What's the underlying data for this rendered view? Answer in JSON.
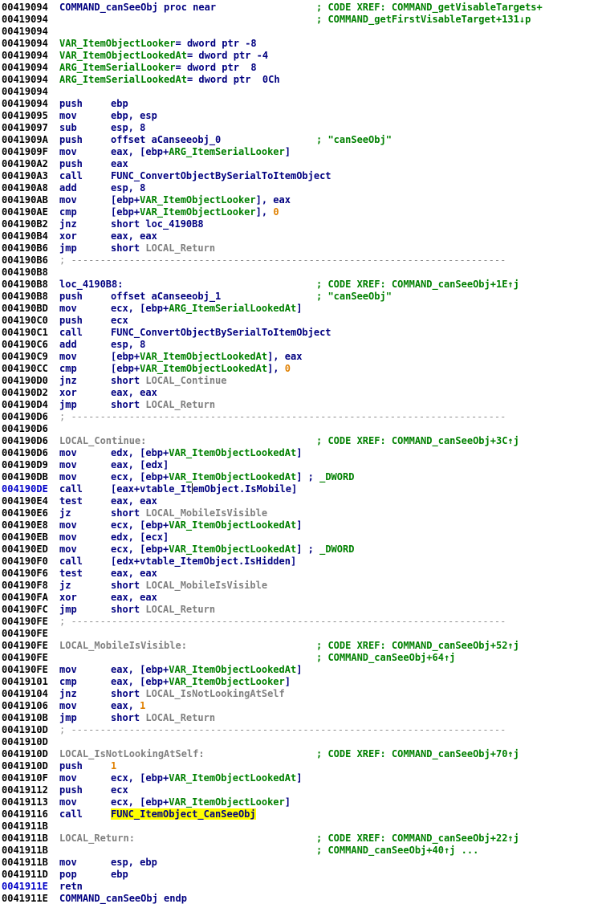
{
  "colors": {
    "background": "#ffffff",
    "address": "#000000",
    "current_address": "#0000c8",
    "instruction": "#000080",
    "comment": "#008000",
    "local_label": "#808080",
    "number": "#e08000",
    "highlight": "#ffff00"
  },
  "lines": [
    {
      "addr": "00419094",
      "lbl": [
        {
          "t": "COMMAND_canSeeObj proc near"
        }
      ],
      "cm": "; CODE XREF: COMMAND_getVisableTargets+"
    },
    {
      "addr": "00419094",
      "cm": "; COMMAND_getFirstVisableTarget+131↓p"
    },
    {
      "addr": "00419094"
    },
    {
      "addr": "00419094",
      "lbl": [
        {
          "t": "VAR_ItemObjectLooker",
          "k": "g"
        },
        {
          "t": "= dword ptr -8"
        }
      ]
    },
    {
      "addr": "00419094",
      "lbl": [
        {
          "t": "VAR_ItemObjectLookedAt",
          "k": "g"
        },
        {
          "t": "= dword ptr -4"
        }
      ]
    },
    {
      "addr": "00419094",
      "lbl": [
        {
          "t": "ARG_ItemSerialLooker",
          "k": "g"
        },
        {
          "t": "= dword ptr  8"
        }
      ]
    },
    {
      "addr": "00419094",
      "lbl": [
        {
          "t": "ARG_ItemSerialLookedAt",
          "k": "g"
        },
        {
          "t": "= dword ptr  0Ch"
        }
      ]
    },
    {
      "addr": "00419094"
    },
    {
      "addr": "00419094",
      "mn": "push",
      "op": [
        {
          "t": "ebp"
        }
      ]
    },
    {
      "addr": "00419095",
      "mn": "mov",
      "op": [
        {
          "t": "ebp, esp"
        }
      ]
    },
    {
      "addr": "00419097",
      "mn": "sub",
      "op": [
        {
          "t": "esp, 8"
        }
      ]
    },
    {
      "addr": "0041909A",
      "mn": "push",
      "op": [
        {
          "t": "offset aCanseeobj_0"
        }
      ],
      "cm": "; \"canSeeObj\""
    },
    {
      "addr": "0041909F",
      "mn": "mov",
      "op": [
        {
          "t": "eax, [ebp+"
        },
        {
          "t": "ARG_ItemSerialLooker",
          "k": "g"
        },
        {
          "t": "]"
        }
      ]
    },
    {
      "addr": "004190A2",
      "mn": "push",
      "op": [
        {
          "t": "eax"
        }
      ]
    },
    {
      "addr": "004190A3",
      "mn": "call",
      "op": [
        {
          "t": "FUNC_ConvertObjectBySerialToItemObject"
        }
      ]
    },
    {
      "addr": "004190A8",
      "mn": "add",
      "op": [
        {
          "t": "esp, 8"
        }
      ]
    },
    {
      "addr": "004190AB",
      "mn": "mov",
      "op": [
        {
          "t": "[ebp+"
        },
        {
          "t": "VAR_ItemObjectLooker",
          "k": "g"
        },
        {
          "t": "], eax"
        }
      ]
    },
    {
      "addr": "004190AE",
      "mn": "cmp",
      "op": [
        {
          "t": "[ebp+"
        },
        {
          "t": "VAR_ItemObjectLooker",
          "k": "g"
        },
        {
          "t": "], "
        },
        {
          "t": "0",
          "k": "nm"
        }
      ]
    },
    {
      "addr": "004190B2",
      "mn": "jnz",
      "op": [
        {
          "t": "short loc_4190B8"
        }
      ]
    },
    {
      "addr": "004190B4",
      "mn": "xor",
      "op": [
        {
          "t": "eax, eax"
        }
      ]
    },
    {
      "addr": "004190B6",
      "mn": "jmp",
      "op": [
        {
          "t": "short "
        },
        {
          "t": "LOCAL_Return",
          "k": "gr"
        }
      ]
    },
    {
      "addr": "004190B6",
      "sep": "; ---------------------------------------------------------------------------"
    },
    {
      "addr": "004190B8"
    },
    {
      "addr": "004190B8",
      "lbl": [
        {
          "t": "loc_4190B8:"
        }
      ],
      "cm": "; CODE XREF: COMMAND_canSeeObj+1E↑j"
    },
    {
      "addr": "004190B8",
      "mn": "push",
      "op": [
        {
          "t": "offset aCanseeobj_1"
        }
      ],
      "cm": "; \"canSeeObj\""
    },
    {
      "addr": "004190BD",
      "mn": "mov",
      "op": [
        {
          "t": "ecx, [ebp+"
        },
        {
          "t": "ARG_ItemSerialLookedAt",
          "k": "g"
        },
        {
          "t": "]"
        }
      ]
    },
    {
      "addr": "004190C0",
      "mn": "push",
      "op": [
        {
          "t": "ecx"
        }
      ]
    },
    {
      "addr": "004190C1",
      "mn": "call",
      "op": [
        {
          "t": "FUNC_ConvertObjectBySerialToItemObject"
        }
      ]
    },
    {
      "addr": "004190C6",
      "mn": "add",
      "op": [
        {
          "t": "esp, 8"
        }
      ]
    },
    {
      "addr": "004190C9",
      "mn": "mov",
      "op": [
        {
          "t": "[ebp+"
        },
        {
          "t": "VAR_ItemObjectLookedAt",
          "k": "g"
        },
        {
          "t": "], eax"
        }
      ]
    },
    {
      "addr": "004190CC",
      "mn": "cmp",
      "op": [
        {
          "t": "[ebp+"
        },
        {
          "t": "VAR_ItemObjectLookedAt",
          "k": "g"
        },
        {
          "t": "], "
        },
        {
          "t": "0",
          "k": "nm"
        }
      ]
    },
    {
      "addr": "004190D0",
      "mn": "jnz",
      "op": [
        {
          "t": "short "
        },
        {
          "t": "LOCAL_Continue",
          "k": "gr"
        }
      ]
    },
    {
      "addr": "004190D2",
      "mn": "xor",
      "op": [
        {
          "t": "eax, eax"
        }
      ]
    },
    {
      "addr": "004190D4",
      "mn": "jmp",
      "op": [
        {
          "t": "short "
        },
        {
          "t": "LOCAL_Return",
          "k": "gr"
        }
      ]
    },
    {
      "addr": "004190D6",
      "sep": "; ---------------------------------------------------------------------------"
    },
    {
      "addr": "004190D6"
    },
    {
      "addr": "004190D6",
      "lbl": [
        {
          "t": "LOCAL_Continue:",
          "k": "gr"
        }
      ],
      "cm": "; CODE XREF: COMMAND_canSeeObj+3C↑j"
    },
    {
      "addr": "004190D6",
      "mn": "mov",
      "op": [
        {
          "t": "edx, [ebp+"
        },
        {
          "t": "VAR_ItemObjectLookedAt",
          "k": "g"
        },
        {
          "t": "]"
        }
      ]
    },
    {
      "addr": "004190D9",
      "mn": "mov",
      "op": [
        {
          "t": "eax, [edx]"
        }
      ]
    },
    {
      "addr": "004190DB",
      "mn": "mov",
      "op": [
        {
          "t": "ecx, [ebp+"
        },
        {
          "t": "VAR_ItemObjectLookedAt",
          "k": "g"
        },
        {
          "t": "] ; "
        },
        {
          "t": "_DWORD",
          "k": "g"
        }
      ]
    },
    {
      "addr": "004190DE",
      "cur": true,
      "mn": "call",
      "op": [
        {
          "t": "[eax+vtable_It"
        },
        {
          "k": "cursor"
        },
        {
          "t": "emObject.IsMobile]"
        }
      ]
    },
    {
      "addr": "004190E4",
      "mn": "test",
      "op": [
        {
          "t": "eax, eax"
        }
      ]
    },
    {
      "addr": "004190E6",
      "mn": "jz",
      "op": [
        {
          "t": "short "
        },
        {
          "t": "LOCAL_MobileIsVisible",
          "k": "gr"
        }
      ]
    },
    {
      "addr": "004190E8",
      "mn": "mov",
      "op": [
        {
          "t": "ecx, [ebp+"
        },
        {
          "t": "VAR_ItemObjectLookedAt",
          "k": "g"
        },
        {
          "t": "]"
        }
      ]
    },
    {
      "addr": "004190EB",
      "mn": "mov",
      "op": [
        {
          "t": "edx, [ecx]"
        }
      ]
    },
    {
      "addr": "004190ED",
      "mn": "mov",
      "op": [
        {
          "t": "ecx, [ebp+"
        },
        {
          "t": "VAR_ItemObjectLookedAt",
          "k": "g"
        },
        {
          "t": "] ; "
        },
        {
          "t": "_DWORD",
          "k": "g"
        }
      ]
    },
    {
      "addr": "004190F0",
      "mn": "call",
      "op": [
        {
          "t": "[edx+vtable_ItemObject.IsHidden]"
        }
      ]
    },
    {
      "addr": "004190F6",
      "mn": "test",
      "op": [
        {
          "t": "eax, eax"
        }
      ]
    },
    {
      "addr": "004190F8",
      "mn": "jz",
      "op": [
        {
          "t": "short "
        },
        {
          "t": "LOCAL_MobileIsVisible",
          "k": "gr"
        }
      ]
    },
    {
      "addr": "004190FA",
      "mn": "xor",
      "op": [
        {
          "t": "eax, eax"
        }
      ]
    },
    {
      "addr": "004190FC",
      "mn": "jmp",
      "op": [
        {
          "t": "short "
        },
        {
          "t": "LOCAL_Return",
          "k": "gr"
        }
      ]
    },
    {
      "addr": "004190FE",
      "sep": "; ---------------------------------------------------------------------------"
    },
    {
      "addr": "004190FE"
    },
    {
      "addr": "004190FE",
      "lbl": [
        {
          "t": "LOCAL_MobileIsVisible:",
          "k": "gr"
        }
      ],
      "cm": "; CODE XREF: COMMAND_canSeeObj+52↑j"
    },
    {
      "addr": "004190FE",
      "cm": "; COMMAND_canSeeObj+64↑j"
    },
    {
      "addr": "004190FE",
      "mn": "mov",
      "op": [
        {
          "t": "eax, [ebp+"
        },
        {
          "t": "VAR_ItemObjectLookedAt",
          "k": "g"
        },
        {
          "t": "]"
        }
      ]
    },
    {
      "addr": "00419101",
      "mn": "cmp",
      "op": [
        {
          "t": "eax, [ebp+"
        },
        {
          "t": "VAR_ItemObjectLooker",
          "k": "g"
        },
        {
          "t": "]"
        }
      ]
    },
    {
      "addr": "00419104",
      "mn": "jnz",
      "op": [
        {
          "t": "short "
        },
        {
          "t": "LOCAL_IsNotLookingAtSelf",
          "k": "gr"
        }
      ]
    },
    {
      "addr": "00419106",
      "mn": "mov",
      "op": [
        {
          "t": "eax, "
        },
        {
          "t": "1",
          "k": "nm"
        }
      ]
    },
    {
      "addr": "0041910B",
      "mn": "jmp",
      "op": [
        {
          "t": "short "
        },
        {
          "t": "LOCAL_Return",
          "k": "gr"
        }
      ]
    },
    {
      "addr": "0041910D",
      "sep": "; ---------------------------------------------------------------------------"
    },
    {
      "addr": "0041910D"
    },
    {
      "addr": "0041910D",
      "lbl": [
        {
          "t": "LOCAL_IsNotLookingAtSelf:",
          "k": "gr"
        }
      ],
      "cm": "; CODE XREF: COMMAND_canSeeObj+70↑j"
    },
    {
      "addr": "0041910D",
      "mn": "push",
      "op": [
        {
          "t": "1",
          "k": "nm"
        }
      ]
    },
    {
      "addr": "0041910F",
      "mn": "mov",
      "op": [
        {
          "t": "ecx, [ebp+"
        },
        {
          "t": "VAR_ItemObjectLookedAt",
          "k": "g"
        },
        {
          "t": "]"
        }
      ]
    },
    {
      "addr": "00419112",
      "mn": "push",
      "op": [
        {
          "t": "ecx"
        }
      ]
    },
    {
      "addr": "00419113",
      "mn": "mov",
      "op": [
        {
          "t": "ecx, [ebp+"
        },
        {
          "t": "VAR_ItemObjectLooker",
          "k": "g"
        },
        {
          "t": "]"
        }
      ]
    },
    {
      "addr": "00419116",
      "mn": "call",
      "op": [
        {
          "t": "FUNC_ItemObject_CanSeeObj",
          "k": "hl"
        }
      ]
    },
    {
      "addr": "0041911B"
    },
    {
      "addr": "0041911B",
      "lbl": [
        {
          "t": "LOCAL_Return:",
          "k": "gr"
        }
      ],
      "cm": "; CODE XREF: COMMAND_canSeeObj+22↑j"
    },
    {
      "addr": "0041911B",
      "cm": "; COMMAND_canSeeObj+40↑j ..."
    },
    {
      "addr": "0041911B",
      "mn": "mov",
      "op": [
        {
          "t": "esp, ebp"
        }
      ]
    },
    {
      "addr": "0041911D",
      "mn": "pop",
      "op": [
        {
          "t": "ebp"
        }
      ]
    },
    {
      "addr": "0041911E",
      "cur": true,
      "mn": "retn"
    },
    {
      "addr": "0041911E",
      "lbl": [
        {
          "t": "COMMAND_canSeeObj endp"
        }
      ]
    }
  ]
}
